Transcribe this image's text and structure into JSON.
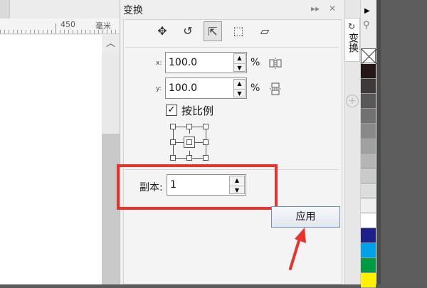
{
  "ruler": {
    "mark_value": "450",
    "unit": "毫米"
  },
  "docker": {
    "title": "变换",
    "controls": [
      "▸▸",
      "✕"
    ]
  },
  "toolbar": {
    "tools": [
      {
        "name": "position-tool",
        "icon": "position-icon",
        "glyph": "✥"
      },
      {
        "name": "rotate-tool",
        "icon": "rotate-icon",
        "glyph": "↺"
      },
      {
        "name": "scale-mirror-tool",
        "icon": "scale-mirror-icon",
        "glyph": "⇱",
        "active": true
      },
      {
        "name": "size-tool",
        "icon": "size-icon",
        "glyph": "⬚"
      },
      {
        "name": "skew-tool",
        "icon": "skew-icon",
        "glyph": "⏥"
      }
    ]
  },
  "scale": {
    "x_label": "x:",
    "x_value": "100.0",
    "x_unit": "%",
    "y_label": "y:",
    "y_value": "100.0",
    "y_unit": "%",
    "spin_up": "▲",
    "spin_down": "▼",
    "mirror_h_icon": "horizontal-mirror-icon",
    "mirror_v_icon": "vertical-mirror-icon"
  },
  "proportional": {
    "label": "按比例",
    "checked": true,
    "check_glyph": "✓"
  },
  "copies": {
    "label": "副本:",
    "value": "1"
  },
  "apply_button": {
    "label": "应用"
  },
  "side_tabs": {
    "transform_label": "变换",
    "transform_icon": "transform-icon",
    "add_glyph": "+"
  },
  "palette": {
    "colors": [
      "#231815",
      "#3e3a39",
      "#595757",
      "#727171",
      "#898989",
      "#9fa0a0",
      "#b5b5b6",
      "#c9caca",
      "#dcdddd",
      "#efefef",
      "#ffffff",
      "#1d2088",
      "#00a0e9",
      "#009944",
      "#fff100"
    ]
  },
  "annotation": {
    "color": "#e8322e"
  }
}
